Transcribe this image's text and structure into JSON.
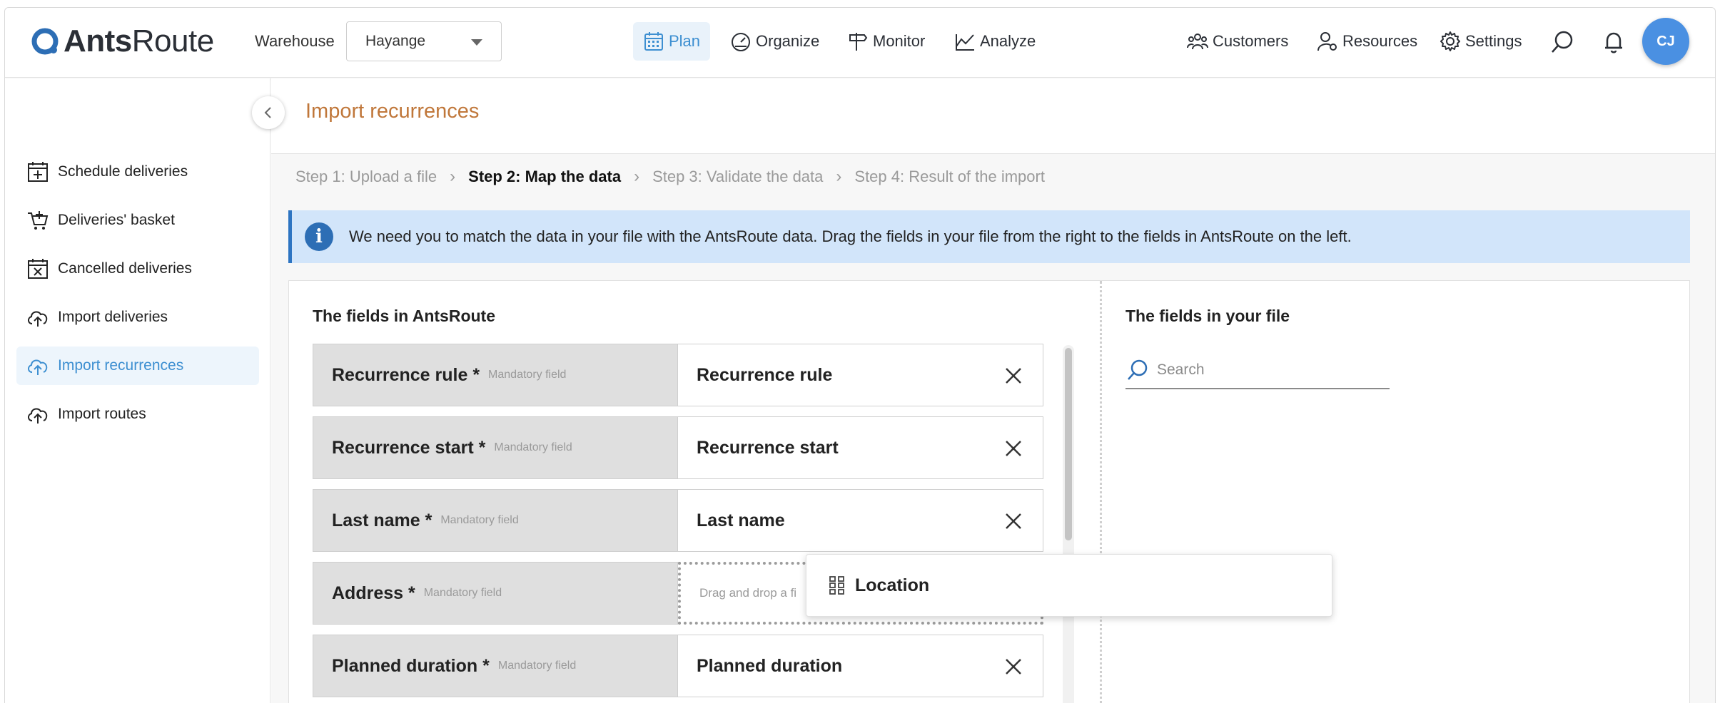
{
  "app": {
    "logo_bold": "Ants",
    "logo_light": "Route"
  },
  "header": {
    "warehouse_label": "Warehouse",
    "warehouse_value": "Hayange",
    "nav": [
      {
        "label": "Plan",
        "icon": "calendar-icon",
        "active": true
      },
      {
        "label": "Organize",
        "icon": "gauge-icon"
      },
      {
        "label": "Monitor",
        "icon": "signpost-icon"
      },
      {
        "label": "Analyze",
        "icon": "chart-icon"
      }
    ],
    "right_nav": [
      {
        "label": "Customers",
        "icon": "customers-icon"
      },
      {
        "label": "Resources",
        "icon": "resources-icon"
      },
      {
        "label": "Settings",
        "icon": "gear-icon"
      }
    ],
    "avatar_initials": "CJ"
  },
  "sidebar": {
    "items": [
      {
        "label": "Schedule deliveries",
        "icon": "calendar-plus-icon"
      },
      {
        "label": "Deliveries' basket",
        "icon": "basket-icon"
      },
      {
        "label": "Cancelled deliveries",
        "icon": "calendar-x-icon"
      },
      {
        "label": "Import deliveries",
        "icon": "cloud-upload-icon"
      },
      {
        "label": "Import recurrences",
        "icon": "cloud-upload-icon",
        "active": true
      },
      {
        "label": "Import routes",
        "icon": "cloud-upload-icon"
      }
    ]
  },
  "main": {
    "page_title": "Import recurrences",
    "steps": [
      "Step 1: Upload a file",
      "Step 2: Map the data",
      "Step 3: Validate the data",
      "Step 4: Result of the import"
    ],
    "current_step": 2,
    "info_text": "We need you to match the data in your file with the AntsRoute data. Drag the fields in your file from the right to the fields in AntsRoute on the left.",
    "left_title": "The fields in AntsRoute",
    "right_title": "The fields in your file",
    "search_placeholder": "Search",
    "mandatory_label": "Mandatory field",
    "drop_placeholder": "Drag and drop a fi",
    "rows": [
      {
        "field": "Recurrence rule *",
        "value": "Recurrence rule"
      },
      {
        "field": "Recurrence start *",
        "value": "Recurrence start"
      },
      {
        "field": "Last name *",
        "value": "Last name"
      },
      {
        "field": "Address *",
        "value": ""
      },
      {
        "field": "Planned duration *",
        "value": "Planned duration"
      }
    ],
    "dragging_chip": "Location"
  },
  "colors": {
    "accent": "#3d8fd1",
    "title": "#c0773a",
    "info_bg": "#d2e5fa",
    "avatar": "#4a90e2"
  }
}
